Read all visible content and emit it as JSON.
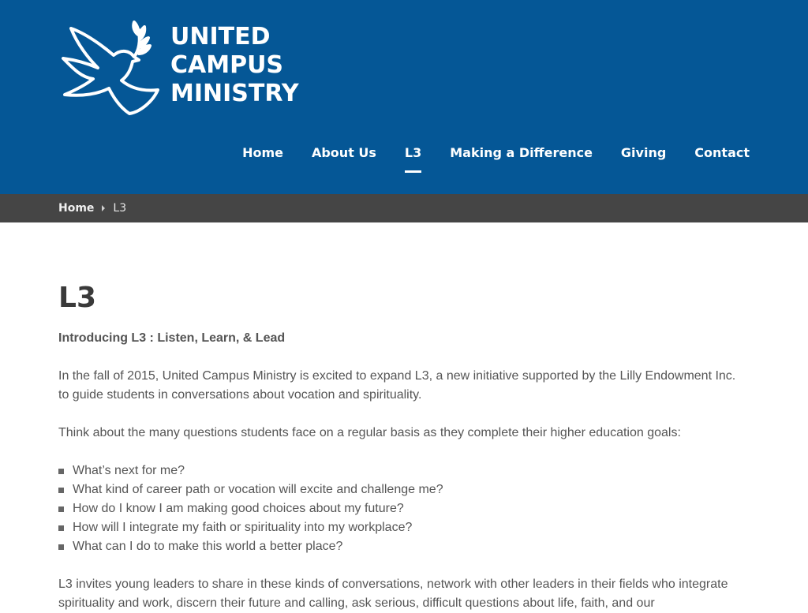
{
  "header": {
    "logo_lines": [
      "UNITED",
      "CAMPUS",
      "MINISTRY"
    ],
    "logo_icon": "dove-with-olive-branch",
    "background": "#055796"
  },
  "nav": {
    "items": [
      {
        "label": "Home",
        "active": false
      },
      {
        "label": "About Us",
        "active": false
      },
      {
        "label": "L3",
        "active": true
      },
      {
        "label": "Making a Difference",
        "active": false
      },
      {
        "label": "Giving",
        "active": false
      },
      {
        "label": "Contact",
        "active": false
      }
    ]
  },
  "breadcrumb": {
    "home": "Home",
    "current": "L3",
    "separator_icon": "caret-right-icon"
  },
  "page": {
    "title": "L3",
    "intro": "Introducing L3 : Listen, Learn, & Lead",
    "paragraph_1": "In the fall of 2015, United Campus Ministry is excited to expand L3, a new initiative supported by the Lilly Endowment Inc. to guide students in conversations about vocation and spirituality.",
    "paragraph_2": "Think about the many questions students face on a regular basis as they complete their higher education goals:",
    "questions": [
      "What’s next for me?",
      "What kind of career path or vocation will excite and challenge me?",
      "How do I know I am making good choices about my future?",
      "How will I integrate my faith or spirituality into my workplace?",
      "What can I do to make this world a better place?"
    ],
    "paragraph_3": "L3 invites young leaders to share in these kinds of conversations, network with other leaders in their fields who integrate spirituality and work, discern their future and calling, ask serious, difficult questions about life, faith, and our"
  }
}
